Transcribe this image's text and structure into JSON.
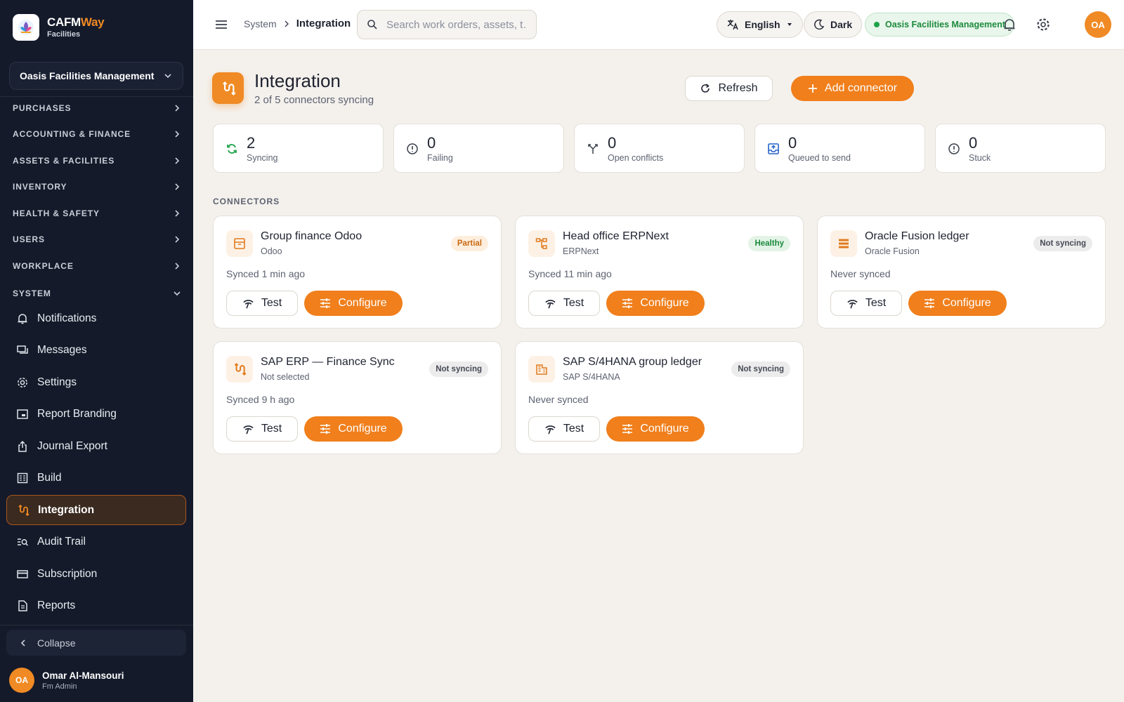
{
  "brand": {
    "name_part1": "CAFM",
    "name_part2": "Way",
    "subtitle": "Facilities"
  },
  "sidebar": {
    "org_selector": "Oasis Facilities Management",
    "sections": [
      {
        "label": "PURCHASES",
        "expanded": false
      },
      {
        "label": "ACCOUNTING & FINANCE",
        "expanded": false
      },
      {
        "label": "ASSETS & FACILITIES",
        "expanded": false
      },
      {
        "label": "INVENTORY",
        "expanded": false
      },
      {
        "label": "HEALTH & SAFETY",
        "expanded": false
      },
      {
        "label": "USERS",
        "expanded": false
      },
      {
        "label": "WORKPLACE",
        "expanded": false
      },
      {
        "label": "SYSTEM",
        "expanded": true
      }
    ],
    "items": [
      {
        "label": "Notifications",
        "icon": "bell-icon"
      },
      {
        "label": "Messages",
        "icon": "messages-icon"
      },
      {
        "label": "Settings",
        "icon": "gear-icon"
      },
      {
        "label": "Report Branding",
        "icon": "branding-icon"
      },
      {
        "label": "Journal Export",
        "icon": "export-icon"
      },
      {
        "label": "Build",
        "icon": "build-icon"
      },
      {
        "label": "Integration",
        "icon": "integration-icon",
        "active": true
      },
      {
        "label": "Audit Trail",
        "icon": "audit-icon"
      },
      {
        "label": "Subscription",
        "icon": "card-icon"
      },
      {
        "label": "Reports",
        "icon": "reports-icon"
      }
    ],
    "collapse_label": "Collapse",
    "user": {
      "initials": "OA",
      "name": "Omar Al-Mansouri",
      "role": "Fm Admin"
    }
  },
  "topbar": {
    "breadcrumb": [
      "System",
      "Integration"
    ],
    "search_placeholder": "Search work orders, assets, t…",
    "language": "English",
    "theme": "Dark",
    "org": "Oasis Facilities Management",
    "avatar_initials": "OA"
  },
  "page": {
    "title": "Integration",
    "subtitle": "2 of 5 connectors syncing",
    "refresh_label": "Refresh",
    "add_label": "Add connector"
  },
  "stats": [
    {
      "value": "2",
      "label": "Syncing",
      "icon": "sync-icon"
    },
    {
      "value": "0",
      "label": "Failing",
      "icon": "alert-circle-icon"
    },
    {
      "value": "0",
      "label": "Open conflicts",
      "icon": "merge-icon"
    },
    {
      "value": "0",
      "label": "Queued to send",
      "icon": "outbox-icon"
    },
    {
      "value": "0",
      "label": "Stuck",
      "icon": "alert-circle-icon"
    }
  ],
  "connectors_heading": "CONNECTORS",
  "connectors": [
    {
      "title": "Group finance Odoo",
      "provider": "Odoo",
      "badge": "Partial",
      "badge_type": "partial",
      "status": "Synced 1 min ago",
      "icon": "archive-icon"
    },
    {
      "title": "Head office ERPNext",
      "provider": "ERPNext",
      "badge": "Healthy",
      "badge_type": "healthy",
      "status": "Synced 11 min ago",
      "icon": "hierarchy-icon"
    },
    {
      "title": "Oracle Fusion ledger",
      "provider": "Oracle Fusion",
      "badge": "Not syncing",
      "badge_type": "none",
      "status": "Never synced",
      "icon": "storage-icon"
    },
    {
      "title": "SAP ERP — Finance Sync",
      "provider": "Not selected",
      "badge": "Not syncing",
      "badge_type": "none",
      "status": "Synced 9 h ago",
      "icon": "integration-icon"
    },
    {
      "title": "SAP S/4HANA group ledger",
      "provider": "SAP S/4HANA",
      "badge": "Not syncing",
      "badge_type": "none",
      "status": "Never synced",
      "icon": "building-icon"
    }
  ],
  "card_actions": {
    "test": "Test",
    "configure": "Configure"
  },
  "colors": {
    "accent": "#f07f1c",
    "sidebar_bg": "#141a2a",
    "page_bg": "#f4f1ed",
    "healthy": "#1c8a3c"
  }
}
